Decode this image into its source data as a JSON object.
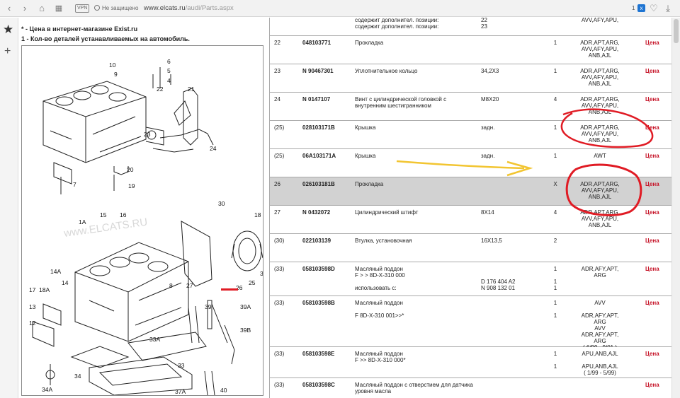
{
  "browser": {
    "vpn_label": "VPN",
    "security_text": "Не защищено",
    "url_domain": "www.elcats.ru",
    "url_path": "/audi/Parts.aspx",
    "extension_count": "1",
    "extension_badge": "x"
  },
  "notes": [
    "* - Цена в интернет-магазине Exist.ru",
    "1 - Кол-во деталей устанавливаемых на автомобиль."
  ],
  "diagram": {
    "watermark": "www.ELCATS.RU",
    "labels": [
      "10",
      "6",
      "5",
      "9",
      "4",
      "22",
      "21",
      "23",
      "24",
      "20",
      "19",
      "7",
      "30",
      "18",
      "15",
      "16",
      "1A",
      "14A",
      "18A",
      "17",
      "14",
      "13",
      "12",
      "26",
      "3",
      "25",
      "27",
      "8",
      "39",
      "39A",
      "39B",
      "33A",
      "33",
      "34A",
      "34",
      "37A",
      "40"
    ]
  },
  "table": {
    "rows": [
      {
        "pos": "",
        "number": "",
        "name": "содержит дополнител. позиции:\nсодержит дополнител. позиции:",
        "note": "22\n23",
        "qty": "",
        "models": "AVV,AFY,APU,",
        "price": ""
      },
      {
        "pos": "22",
        "number": "048103771",
        "name": "Прокладка",
        "note": "",
        "qty": "1",
        "models": "ADR,APT,ARG,\nAVV,AFY,APU,\nANB,AJL",
        "price": "Цена"
      },
      {
        "pos": "23",
        "number": "N 90467301",
        "name": "Уплотнительное кольцо",
        "note": "34,2X3",
        "qty": "1",
        "models": "ADR,APT,ARG,\nAVV,AFY,APU,\nANB,AJL",
        "price": "Цена"
      },
      {
        "pos": "24",
        "number": "N 0147107",
        "name": "Винт с цилиндрической головкой с\nвнутренним шестигранником",
        "note": "M8X20",
        "qty": "4",
        "models": "ADR,APT,ARG,\nAVV,AFY,APU,\nANB,AJL",
        "price": "Цена"
      },
      {
        "pos": "(25)",
        "number": "028103171B",
        "name": "Крышка",
        "note": "задн.",
        "qty": "1",
        "models": "ADR,APT,ARG,\nAVV,AFY,APU,\nANB,AJL",
        "price": "Цена"
      },
      {
        "pos": "(25)",
        "number": "06A103171A",
        "name": "Крышка",
        "note": "задн.",
        "qty": "1",
        "models": "AWT",
        "price": "Цена"
      },
      {
        "pos": "26",
        "number": "026103181B",
        "name": "Прокладка",
        "note": "",
        "qty": "X",
        "models": "ADR,APT,ARG,\nAVV,AFY,APU,\nANB,AJL",
        "price": "Цена"
      },
      {
        "pos": "27",
        "number": "N 0432072",
        "name": "Цилиндрический штифт",
        "note": "8X14",
        "qty": "4",
        "models": "ADR,APT,ARG,\nAVV,AFY,APU,\nANB,AJL",
        "price": "Цена"
      },
      {
        "pos": "(30)",
        "number": "022103139",
        "name": "Втулка, установочная",
        "note": "16X13,5",
        "qty": "2",
        "models": "",
        "price": "Цена"
      },
      {
        "pos": "(33)",
        "number": "058103598D",
        "name": "Масляный поддон\nF > > 8D-X-310 000\n\nиспользовать с:",
        "note": "\n\nD 176 404 A2\nN 908 132 01",
        "qty": "1\n\n1\n1",
        "models": "ADR,AFY,APT,\nARG",
        "price": "Цена"
      },
      {
        "pos": "(33)",
        "number": "058103598B",
        "name": "Масляный поддон\n\nF 8D-X-310 001>>*",
        "note": "",
        "qty": "1\n\n1",
        "models": "AVV\n\nADR,AFY,APT,\nARG\nAVV\nADR,AFY,APT,\nARG\n( 6/99 - 9/01 )",
        "price": "Цена"
      },
      {
        "pos": "(33)",
        "number": "058103598E",
        "name": "Масляный поддон\nF >> 8D-X-310 000*",
        "note": "",
        "qty": "1\n\n1",
        "models": "APU,ANB,AJL\n\nAPU,ANB,AJL\n( 1/99 - 5/99)",
        "price": "Цена"
      },
      {
        "pos": "(33)",
        "number": "058103598C",
        "name": "Масляный поддон с отверстием для датчика\nуровня масла",
        "note": "",
        "qty": "",
        "models": "",
        "price": "Цена"
      }
    ]
  },
  "colors": {
    "price": "#c6162a",
    "highlight_row": "#d2d2d2",
    "annotation_red": "#e01b24",
    "annotation_yellow": "#f2c531"
  }
}
